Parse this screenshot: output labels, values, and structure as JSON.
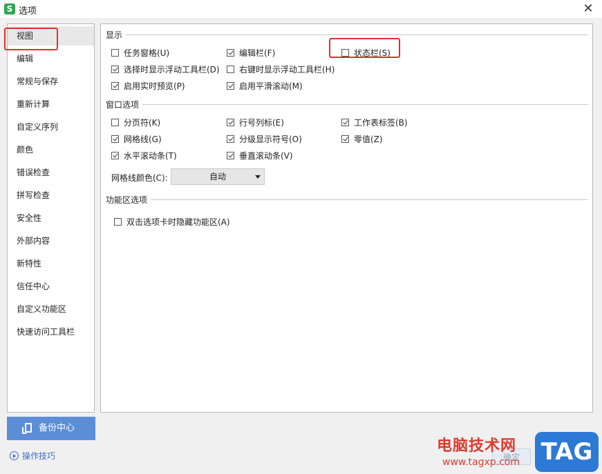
{
  "window": {
    "title": "选项",
    "close_glyph": "✕",
    "app_logo_letter": "S",
    "app_logo_icon": "wps-spreadsheet-icon"
  },
  "sidebar": {
    "items": [
      {
        "label": "视图",
        "active": true
      },
      {
        "label": "编辑"
      },
      {
        "label": "常规与保存"
      },
      {
        "label": "重新计算"
      },
      {
        "label": "自定义序列"
      },
      {
        "label": "颜色"
      },
      {
        "label": "错误检查"
      },
      {
        "label": "拼写检查"
      },
      {
        "label": "安全性"
      },
      {
        "label": "外部内容"
      },
      {
        "label": "新特性"
      },
      {
        "label": "信任中心"
      },
      {
        "label": "自定义功能区"
      },
      {
        "label": "快速访问工具栏"
      }
    ]
  },
  "backup": {
    "label": "备份中心",
    "icon": "backup-icon"
  },
  "tips": {
    "label": "操作技巧",
    "icon": "play-circle-icon"
  },
  "display": {
    "title": "显示",
    "task_pane": {
      "label": "任务窗格(U)",
      "checked": false
    },
    "edit_bar": {
      "label": "编辑栏(F)",
      "checked": true
    },
    "status_bar": {
      "label": "状态栏(S)",
      "checked": false
    },
    "float_toolbar_select": {
      "label": "选择时显示浮动工具栏(D)",
      "checked": true
    },
    "float_toolbar_rightclick": {
      "label": "右键时显示浮动工具栏(H)",
      "checked": false
    },
    "live_preview": {
      "label": "启用实时预览(P)",
      "checked": true
    },
    "smooth_scroll": {
      "label": "启用平滑滚动(M)",
      "checked": true
    }
  },
  "window_options": {
    "title": "窗口选项",
    "page_break": {
      "label": "分页符(K)",
      "checked": false
    },
    "row_col_headers": {
      "label": "行号列标(E)",
      "checked": true
    },
    "sheet_tabs": {
      "label": "工作表标签(B)",
      "checked": true
    },
    "gridlines": {
      "label": "网格线(G)",
      "checked": true
    },
    "outline_symbols": {
      "label": "分级显示符号(O)",
      "checked": true
    },
    "zero_values": {
      "label": "零值(Z)",
      "checked": true
    },
    "h_scrollbar": {
      "label": "水平滚动条(T)",
      "checked": true
    },
    "v_scrollbar": {
      "label": "垂直滚动条(V)",
      "checked": true
    },
    "gridline_color_label": "网格线颜色(C):",
    "gridline_color_value": "自动"
  },
  "ribbon": {
    "title": "功能区选项",
    "hide_on_dblclick": {
      "label": "双击选项卡时隐藏功能区(A)",
      "checked": false
    }
  },
  "confirm_button": {
    "label": "确定"
  },
  "watermark": {
    "cn": "电脑技术网",
    "url": "www.tagxp.com",
    "badge": "TAG"
  },
  "colors": {
    "highlight": "#e0302c",
    "accent": "#5b8ed6",
    "logo": "#2fa84f"
  }
}
